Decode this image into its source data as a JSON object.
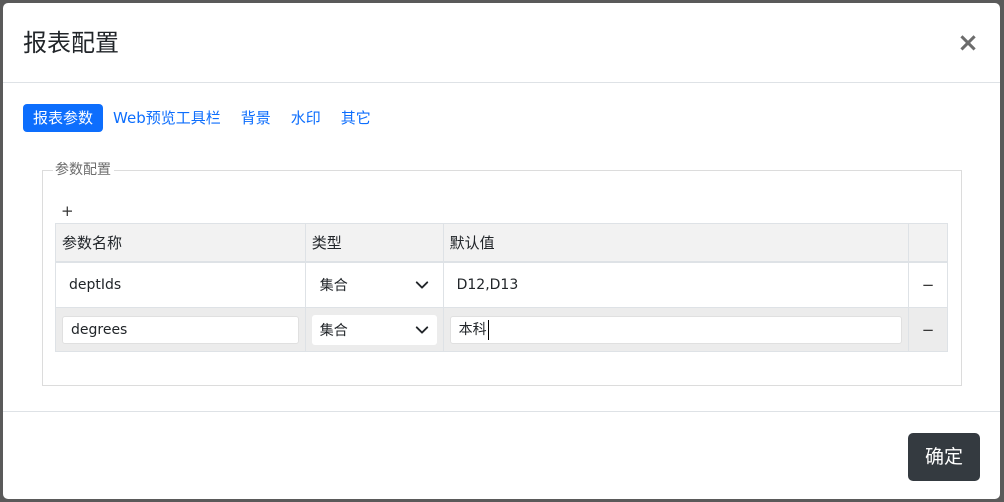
{
  "dialog": {
    "title": "报表配置",
    "close_label": "×"
  },
  "tabs": [
    {
      "label": "报表参数",
      "active": true
    },
    {
      "label": "Web预览工具栏",
      "active": false
    },
    {
      "label": "背景",
      "active": false
    },
    {
      "label": "水印",
      "active": false
    },
    {
      "label": "其它",
      "active": false
    }
  ],
  "params_section": {
    "legend": "参数配置",
    "add_label": "+",
    "columns": [
      "参数名称",
      "类型",
      "默认值",
      ""
    ],
    "rows": [
      {
        "name": "deptIds",
        "type": "集合",
        "default": "D12,D13",
        "remove_label": "−",
        "editing": false
      },
      {
        "name": "degrees",
        "type": "集合",
        "default": "本科",
        "remove_label": "−",
        "editing": true
      }
    ]
  },
  "footer": {
    "confirm_label": "确定"
  },
  "colors": {
    "primary": "#0d6efd",
    "dark_button": "#343a40",
    "overlay": "#5a5a5a"
  }
}
